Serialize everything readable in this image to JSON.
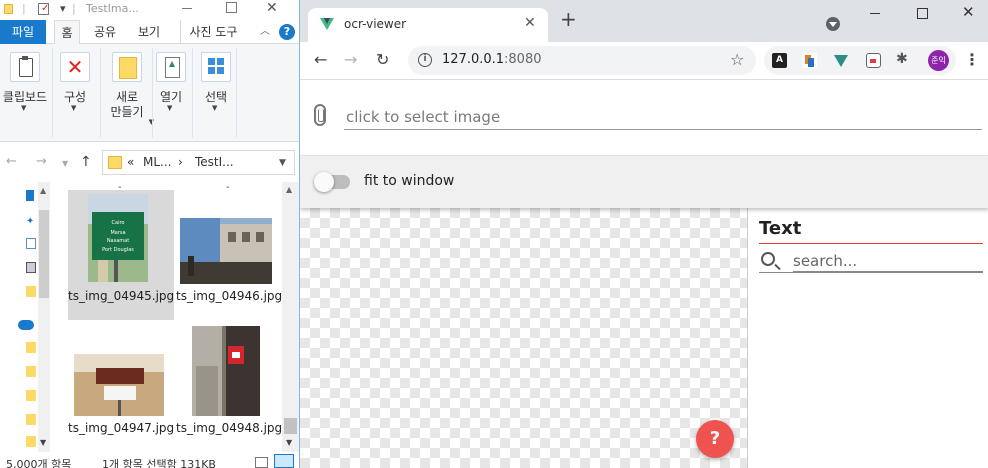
{
  "explorer": {
    "title": "TestIma...",
    "quick_access": "▾",
    "ribbon_tabs": {
      "file": "파일",
      "home": "홈",
      "share": "공유",
      "view": "보기",
      "photo_tools": "사진 도구",
      "help": "?"
    },
    "ribbon_groups": {
      "clipboard": "클립보드",
      "organize": "구성",
      "new": "새로\n만들기",
      "open": "열기",
      "select": "선택"
    },
    "address": {
      "overflow": "«",
      "crumb1": "ML...",
      "crumb2": "TestI..."
    },
    "files": [
      {
        "name": "ts_img_04945.jpg",
        "selected": true
      },
      {
        "name": "ts_img_04946.jpg",
        "selected": false
      },
      {
        "name": "ts_img_04947.jpg",
        "selected": false
      },
      {
        "name": "ts_img_04948.jpg",
        "selected": false
      }
    ],
    "thumb_sign_lines": [
      "Cairo",
      "Marsa",
      "Nasamat",
      "Port Douglas"
    ],
    "status": {
      "count": "5,000개 항목",
      "selection": "1개 항목 선택함 131KB"
    }
  },
  "browser": {
    "tab_title": "ocr-viewer",
    "new_tab": "+",
    "url_host": "127.0.0.1",
    "url_port": ":8080",
    "ext_letter": "A",
    "avatar": "준익",
    "colors": {
      "vue_green": "#41b883",
      "accent_red": "#e53935",
      "fab_red": "#ef5350",
      "win_blue": "#1979ca"
    }
  },
  "app": {
    "file_placeholder": "click to select image",
    "fit_label": "fit to window",
    "fit_enabled": false,
    "side_title": "Text",
    "search_placeholder": "search...",
    "help_label": "?"
  }
}
